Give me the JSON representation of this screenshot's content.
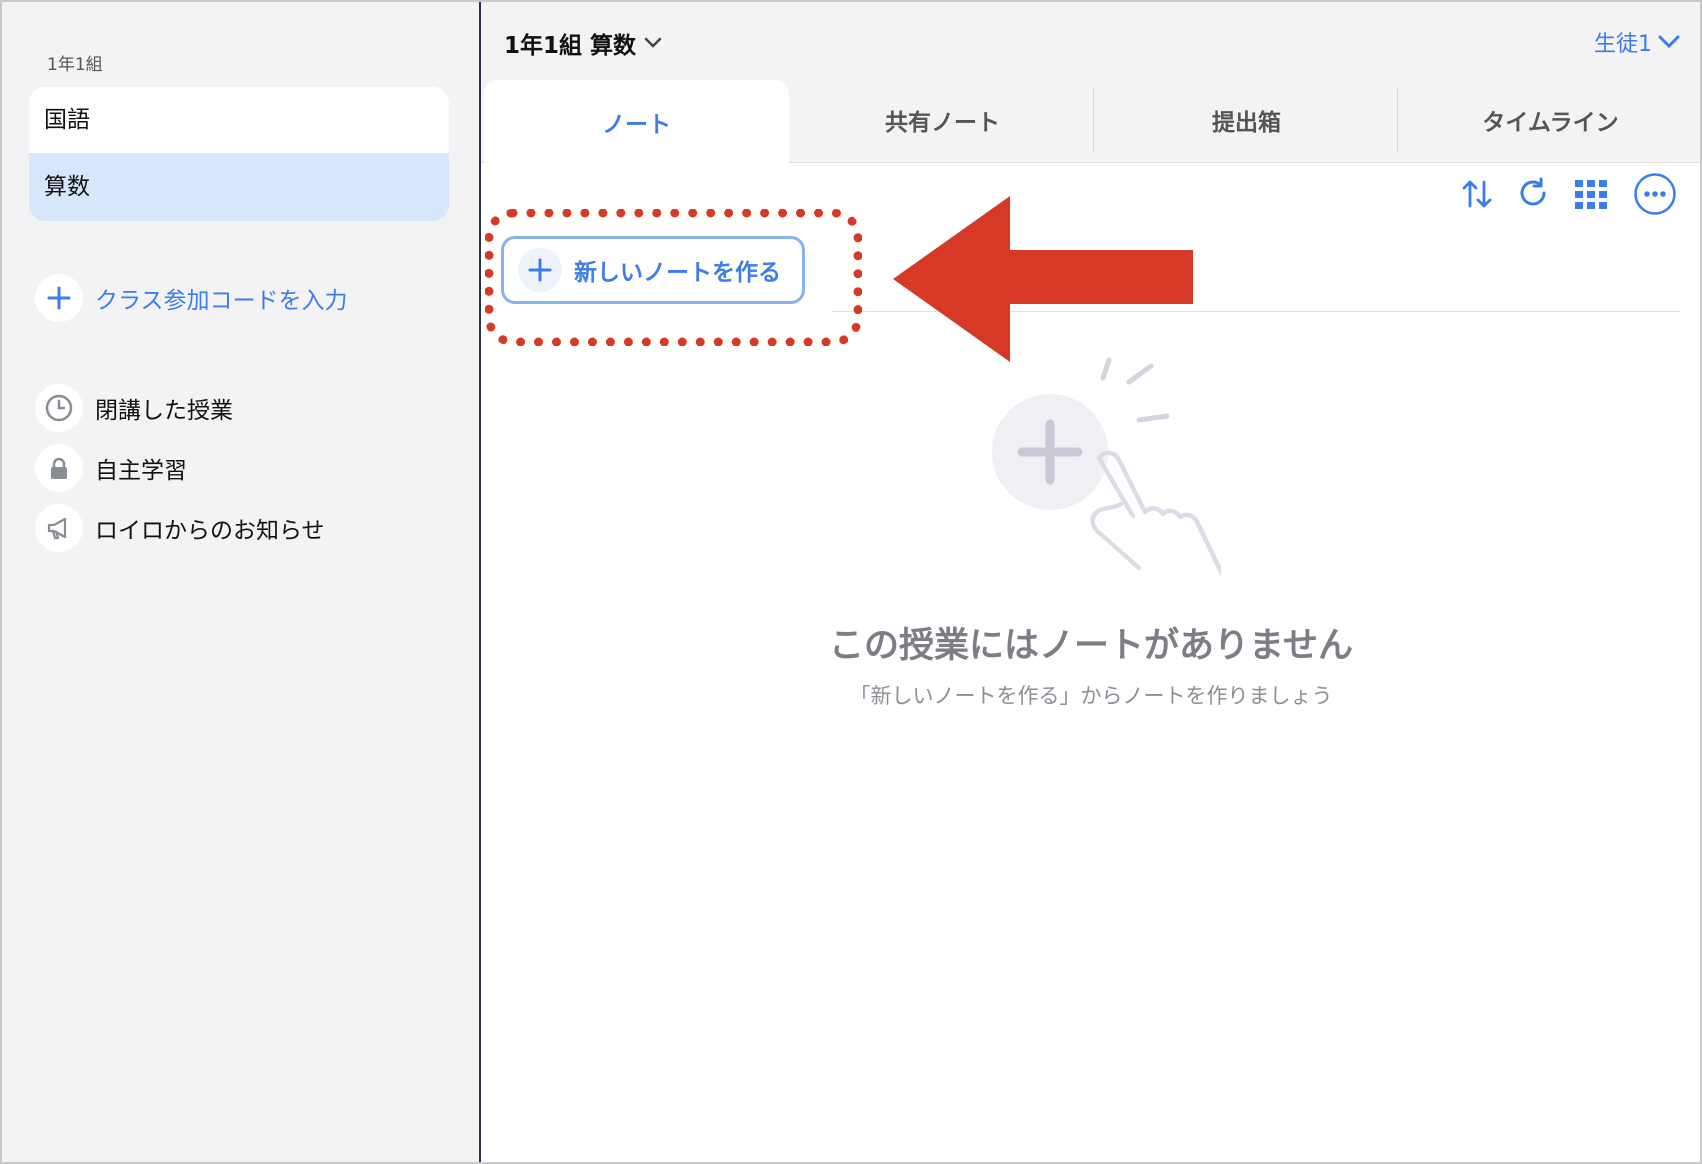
{
  "sidebar": {
    "class_name": "1年1組",
    "subjects": [
      {
        "label": "国語"
      },
      {
        "label": "算数"
      }
    ],
    "join_code": "クラス参加コードを入力",
    "links": [
      {
        "label": "閉講した授業",
        "icon": "clock-icon"
      },
      {
        "label": "自主学習",
        "icon": "lock-icon"
      },
      {
        "label": "ロイロからのお知らせ",
        "icon": "megaphone-icon"
      }
    ]
  },
  "header": {
    "title": "1年1組 算数",
    "user": "生徒1"
  },
  "tabs": [
    {
      "label": "ノート"
    },
    {
      "label": "共有ノート"
    },
    {
      "label": "提出箱"
    },
    {
      "label": "タイムライン"
    }
  ],
  "toolbar": {
    "icons": [
      "sort-icon",
      "refresh-icon",
      "grid-icon",
      "more-icon"
    ]
  },
  "notes": {
    "new_note_label": "新しいノートを作る",
    "empty_title": "この授業にはノートがありません",
    "empty_subtitle": "「新しいノートを作る」からノートを作りましょう"
  },
  "colors": {
    "accent": "#3b7ee8",
    "selected": "#d8e6fb",
    "annotation": "#d63a27"
  }
}
